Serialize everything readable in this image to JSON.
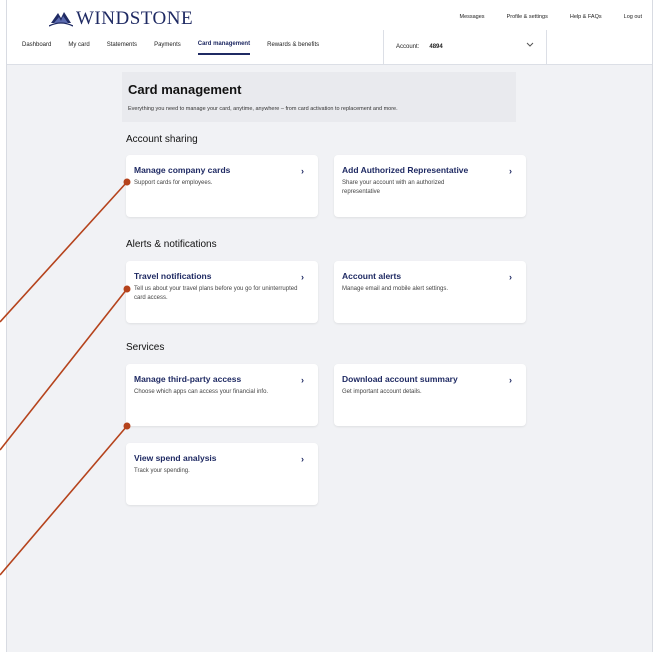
{
  "brand": {
    "name": "WINDSTONE",
    "color": "#1f2a63",
    "logo_icon": "windstone-bird-logo"
  },
  "utility_links": [
    "Messages",
    "Profile & settings",
    "Help & FAQs",
    "Log out"
  ],
  "nav": {
    "tabs": [
      "Dashboard",
      "My card",
      "Statements",
      "Payments",
      "Card management",
      "Rewards & benefits"
    ],
    "active_tab": "Card management"
  },
  "account_select": {
    "label": "Account:",
    "number": "4894"
  },
  "page": {
    "title": "Card management",
    "description": "Everything you need to manage your card, anytime, anywhere – from card activation to replacement and more."
  },
  "sections": [
    {
      "title": "Account sharing",
      "cards": [
        {
          "title": "Manage company cards",
          "desc": "Support cards for employees."
        },
        {
          "title": "Add Authorized Representative",
          "desc": "Share your account with an authorized representative"
        }
      ]
    },
    {
      "title": "Alerts & notifications",
      "cards": [
        {
          "title": "Travel notifications",
          "desc": "Tell us about your travel plans before you go for uninterrupted card access."
        },
        {
          "title": "Account alerts",
          "desc": "Manage email and mobile alert settings."
        }
      ]
    },
    {
      "title": "Services",
      "cards": [
        {
          "title": "Manage third-party access",
          "desc": "Choose which apps can access your financial info."
        },
        {
          "title": "Download account summary",
          "desc": "Get important account details."
        },
        {
          "title": "View spend analysis",
          "desc": "Track your spending."
        }
      ]
    }
  ],
  "chevron": "›",
  "annotation_color": "#b5431c"
}
